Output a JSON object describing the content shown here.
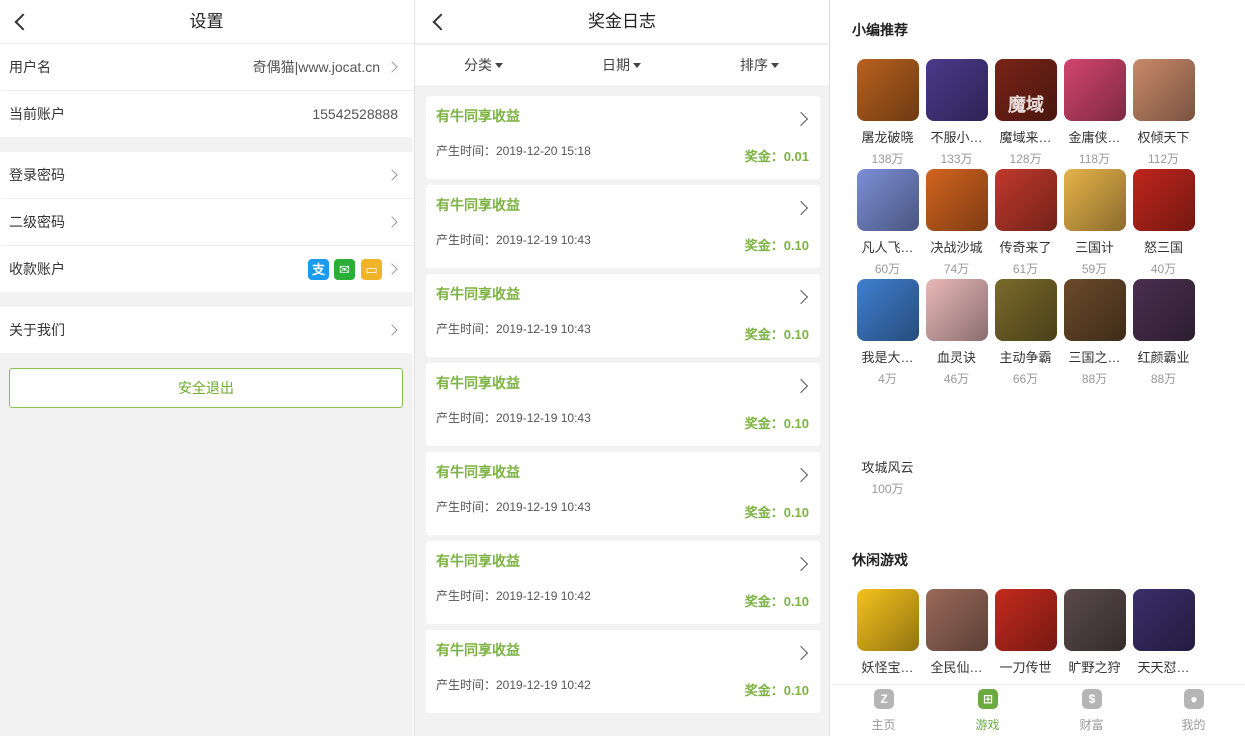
{
  "settings": {
    "title": "设置",
    "rows": [
      {
        "label": "用户名",
        "value": "奇偶猫|www.jocat.cn"
      },
      {
        "label": "当前账户",
        "value": "15542528888"
      },
      {
        "label": "登录密码"
      },
      {
        "label": "二级密码"
      },
      {
        "label": "收款账户"
      },
      {
        "label": "关于我们"
      }
    ],
    "payment_icons": [
      {
        "name": "alipay-icon",
        "glyph": "支",
        "color": "#1a9bf0"
      },
      {
        "name": "wechat-icon",
        "glyph": "✉",
        "color": "#2aae35"
      },
      {
        "name": "bank-card-icon",
        "glyph": "▭",
        "color": "#f0b429"
      }
    ],
    "logout": "安全退出"
  },
  "bonus_log": {
    "title": "奖金日志",
    "filters": [
      "分类",
      "日期",
      "排序"
    ],
    "entries": [
      {
        "title": "有牛同享收益",
        "time": "产生时间：2019-12-20 15:18",
        "prize": "奖金：0.01"
      },
      {
        "title": "有牛同享收益",
        "time": "产生时间：2019-12-19 10:43",
        "prize": "奖金：0.10"
      },
      {
        "title": "有牛同享收益",
        "time": "产生时间：2019-12-19 10:43",
        "prize": "奖金：0.10"
      },
      {
        "title": "有牛同享收益",
        "time": "产生时间：2019-12-19 10:43",
        "prize": "奖金：0.10"
      },
      {
        "title": "有牛同享收益",
        "time": "产生时间：2019-12-19 10:43",
        "prize": "奖金：0.10"
      },
      {
        "title": "有牛同享收益",
        "time": "产生时间：2019-12-19 10:42",
        "prize": "奖金：0.10"
      },
      {
        "title": "有牛同享收益",
        "time": "产生时间：2019-12-19 10:42",
        "prize": "奖金：0.10"
      }
    ]
  },
  "games": {
    "featured_title": "小编推荐",
    "featured": [
      {
        "name": "屠龙破晓",
        "plays": "138万",
        "color": "#b8611e"
      },
      {
        "name": "不服小…",
        "plays": "133万",
        "color": "#4b3a8c"
      },
      {
        "name": "魔域来…",
        "plays": "128万",
        "color": "#7a2418",
        "glyph": "魔域"
      },
      {
        "name": "金庸侠…",
        "plays": "118万",
        "color": "#d2456e"
      },
      {
        "name": "权倾天下",
        "plays": "112万",
        "color": "#c98a6a"
      },
      {
        "name": "凡人飞…",
        "plays": "60万",
        "color": "#7b8fd6"
      },
      {
        "name": "决战沙城",
        "plays": "74万",
        "color": "#d2641f"
      },
      {
        "name": "传奇来了",
        "plays": "61万",
        "color": "#c0392b"
      },
      {
        "name": "三国计",
        "plays": "59万",
        "color": "#e6b34a"
      },
      {
        "name": "怒三国",
        "plays": "40万",
        "color": "#c0261c"
      },
      {
        "name": "我是大…",
        "plays": "4万",
        "color": "#3f7fcf"
      },
      {
        "name": "血灵诀",
        "plays": "46万",
        "color": "#e8b8b8"
      },
      {
        "name": "主动争霸",
        "plays": "66万",
        "color": "#7a6a2a"
      },
      {
        "name": "三国之…",
        "plays": "88万",
        "color": "#6a4a2a"
      },
      {
        "name": "红颜霸业",
        "plays": "88万",
        "color": "#4a3050"
      },
      {
        "name": "攻城风云",
        "plays": "100万",
        "color": "#ffffff"
      }
    ],
    "casual_title": "休闲游戏",
    "casual": [
      {
        "name": "妖怪宝…",
        "color": "#f4c21d"
      },
      {
        "name": "全民仙…",
        "color": "#9a6a5a"
      },
      {
        "name": "一刀传世",
        "color": "#c42a1e"
      },
      {
        "name": "旷野之狩",
        "color": "#5a4a4a"
      },
      {
        "name": "天天怼…",
        "color": "#3a2f6a"
      }
    ]
  },
  "tabbar": [
    {
      "label": "主页",
      "glyph": "Z"
    },
    {
      "label": "游戏",
      "glyph": "⊞"
    },
    {
      "label": "财富",
      "glyph": "$"
    },
    {
      "label": "我的",
      "glyph": "●"
    }
  ]
}
